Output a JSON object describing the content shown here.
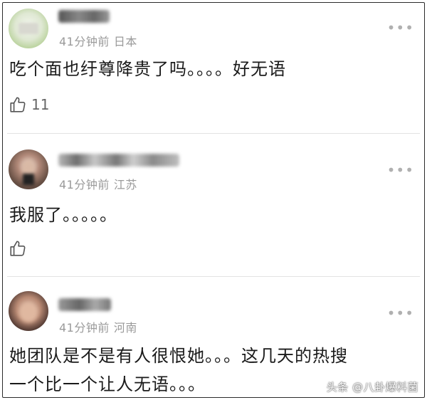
{
  "comments": [
    {
      "meta_time": "41分钟前",
      "meta_location": "日本",
      "text": "吃个面也纡尊降贵了吗。。。。好无语",
      "like_count": "11",
      "more_icon": "more-dots-icon"
    },
    {
      "meta_time": "41分钟前",
      "meta_location": "江苏",
      "text": "我服了。。。。。",
      "like_count": "",
      "more_icon": "more-dots-icon"
    },
    {
      "meta_time": "41分钟前",
      "meta_location": "河南",
      "text_line1": "她团队是不是有人很恨她。。。这几天的热搜",
      "text_line2": "一个比一个让人无语。。。",
      "more_icon": "more-dots-icon"
    }
  ],
  "watermark": "头条 @八卦爆料菌",
  "colors": {
    "text": "#1a1a1a",
    "meta": "#9a9a9a",
    "divider": "#e3e3e3",
    "icon": "#555555"
  }
}
